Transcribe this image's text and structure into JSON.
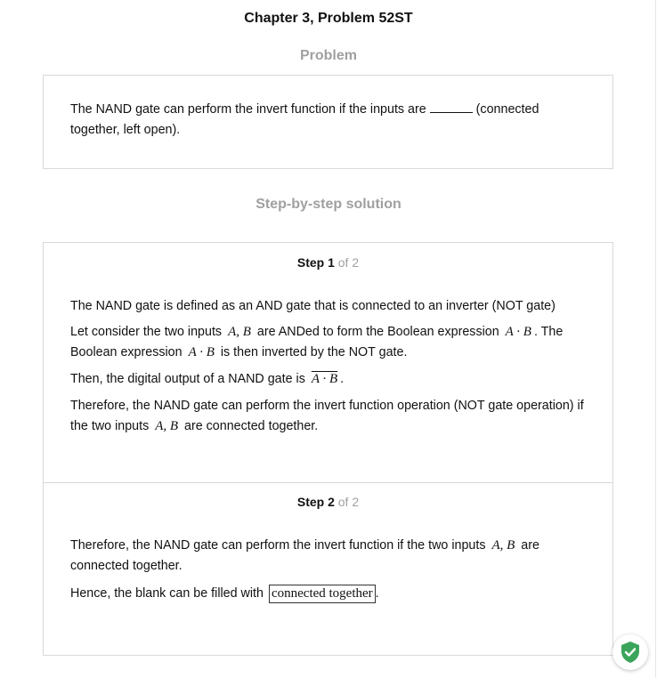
{
  "page": {
    "title": "Chapter 3, Problem 52ST"
  },
  "problem": {
    "heading": "Problem",
    "text_before_blank": "The NAND gate can perform the invert function if the inputs are ",
    "text_after_blank": " (connected together, left open)."
  },
  "solution": {
    "heading": "Step-by-step solution",
    "steps": [
      {
        "label": "Step 1",
        "of_total": "of 2",
        "lines": {
          "p1": "The NAND gate is defined as an AND gate that is connected to an inverter (NOT gate)",
          "p2a": "Let consider the two inputs",
          "p2_math1": "A, B",
          "p2b": "are ANDed to form the Boolean expression",
          "p2_math2": "A · B",
          "p2c": ". The Boolean expression",
          "p2_math3": "A · B",
          "p2d": "is then inverted by the NOT gate.",
          "p3a": "Then, the digital output of a NAND gate is",
          "p3_math": "A · B",
          "p3b": ".",
          "p4a": "Therefore, the NAND gate can perform the invert function operation (NOT gate operation) if the two inputs",
          "p4_math": "A, B",
          "p4b": "are connected together."
        }
      },
      {
        "label": "Step 2",
        "of_total": "of 2",
        "lines": {
          "p1a": "Therefore, the NAND gate can perform the invert function if the two inputs",
          "p1_math": "A, B",
          "p1b": "are connected together.",
          "p2a": "Hence, the blank can be filled with",
          "p2_answer": "connected together",
          "p2b": "."
        }
      }
    ]
  },
  "widget": {
    "icon": "shield-check-icon",
    "color": "#3aa55a"
  }
}
